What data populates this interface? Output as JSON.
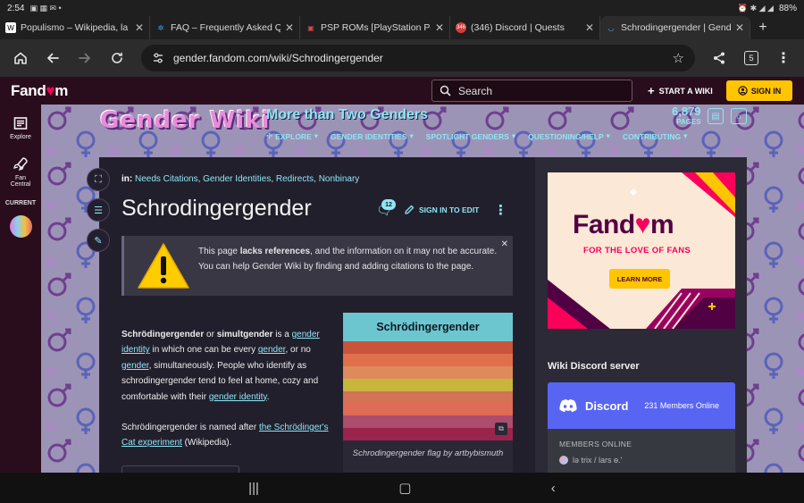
{
  "status_bar": {
    "time": "2:54",
    "battery": "88%"
  },
  "tabs": [
    {
      "title": "Populismo – Wikipedia, la enciclopedia libre",
      "favicon": "W",
      "color": "#ffffff"
    },
    {
      "title": "FAQ – Frequently Asked Questions",
      "favicon": "✲",
      "color": "#3fa9f5"
    },
    {
      "title": "PSP ROMs [PlayStation Portable]",
      "favicon": "▣",
      "color": "#d44b4b"
    },
    {
      "title": "(346) Discord | Quests",
      "favicon": "346",
      "color": "#d43d3d"
    },
    {
      "title": "Schrodingergender | Gender Wiki",
      "favicon": "◡",
      "color": "#5aa0e0",
      "active": true
    }
  ],
  "toolbar": {
    "url": "gender.fandom.com/wiki/Schrodingergender",
    "tab_count": "5"
  },
  "fandom": {
    "logo_text_a": "Fand",
    "logo_text_b": "m",
    "search_placeholder": "Search",
    "start_wiki": "START A WIKI",
    "sign_in": "SIGN IN"
  },
  "rail": {
    "explore": "Explore",
    "fan_central_1": "Fan",
    "fan_central_2": "Central",
    "current": "CURRENT"
  },
  "community": {
    "wordmark": "Gender Wiki",
    "tagline": "More than Two Genders",
    "page_count": "6,879",
    "page_label": "PAGES",
    "nav": [
      "EXPLORE",
      "GENDER IDENTITIES",
      "SPOTLIGHT GENDERS",
      "QUESTIONING/HELP",
      "CONTRIBUTING"
    ]
  },
  "article": {
    "in_label": "in:",
    "categories": [
      "Needs Citations",
      "Gender Identities",
      "Redirects",
      "Nonbinary"
    ],
    "title": "Schrodingergender",
    "talk_count": "12",
    "edit_label": "SIGN IN TO EDIT",
    "notice": {
      "pre": "This page ",
      "bold": "lacks references",
      "post": ", and the information on it may not be accurate. You can help Gender Wiki by finding and adding citations to the page."
    },
    "p1": {
      "b1": "Schrödingergender",
      "t1": " or ",
      "b2": "simultgender",
      "t2": " is a ",
      "l1": "gender identity",
      "t3": " in which one can be every ",
      "l2": "gender",
      "t4": ", or no ",
      "l3": "gender",
      "t5": ", simultaneously. People who identify as schrodingergender tend to feel at home, cozy and comfortable with their ",
      "l4": "gender identity",
      "t6": "."
    },
    "p2": {
      "t1": "Schrödingergender is named after ",
      "l1": "the Schrödinger's Cat experiment",
      "t2": " (Wikipedia)."
    }
  },
  "infobox": {
    "title": "Schrödingergender",
    "caption": "Schrodingergender flag by artbybismuth",
    "flag_colors": [
      "#c8543b",
      "#e06f4c",
      "#df8a5a",
      "#c8b53c",
      "#d37254",
      "#e06b56",
      "#ad4c6c",
      "#9a244c"
    ]
  },
  "ad": {
    "logo_a": "Fand",
    "logo_b": "m",
    "tagline": "FOR THE LOVE OF FANS",
    "button": "LEARN MORE"
  },
  "discord": {
    "heading": "Wiki Discord server",
    "brand": "Discord",
    "online": "231 Members Online",
    "members_heading": "MEMBERS ONLINE",
    "member_1": "lə trix / lars ɵ.'"
  },
  "colors": {
    "accent": "#8ee6f5",
    "fandom_pink": "#fa005a",
    "discord": "#5865f2",
    "sign_in": "#ffc500"
  }
}
